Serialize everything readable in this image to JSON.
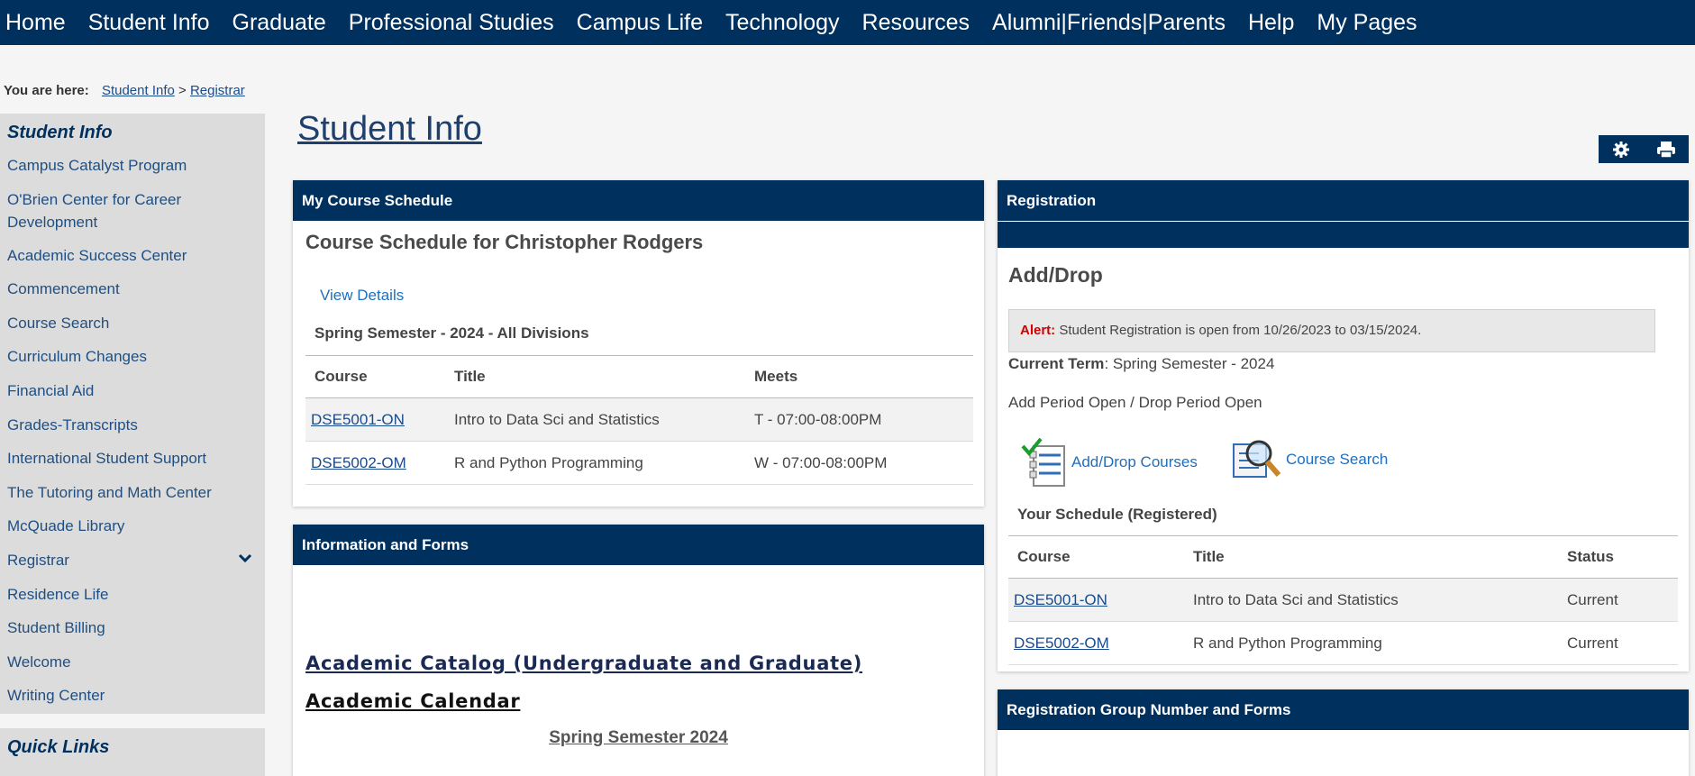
{
  "nav": [
    "Home",
    "Student Info",
    "Graduate",
    "Professional Studies",
    "Campus Life",
    "Technology",
    "Resources",
    "Alumni|Friends|Parents",
    "Help",
    "My Pages"
  ],
  "breadcrumb": {
    "label": "You are here:",
    "items": [
      "Student Info",
      "Registrar"
    ],
    "separator": ">"
  },
  "sidebar": {
    "heading": "Student Info",
    "items": [
      "Campus Catalyst Program",
      "O'Brien Center for Career Development",
      "Academic Success Center",
      "Commencement",
      "Course Search",
      "Curriculum Changes",
      "Financial Aid",
      "Grades-Transcripts",
      "International Student Support",
      "The Tutoring and Math Center",
      "McQuade Library",
      "Registrar",
      "Residence Life",
      "Student Billing",
      "Welcome",
      "Writing Center"
    ],
    "expanded_item_icon": "chevron-down-icon",
    "quick_links_heading": "Quick Links"
  },
  "page_title": "Student Info",
  "tools": {
    "settings_icon": "gear-icon",
    "print_icon": "printer-icon"
  },
  "schedule": {
    "panel_title": "My Course Schedule",
    "heading": "Course Schedule for Christopher Rodgers",
    "view_details": "View Details",
    "semester": "Spring Semester - 2024 - All Divisions",
    "columns": [
      "Course",
      "Title",
      "Meets"
    ],
    "rows": [
      {
        "course": "DSE5001-ON",
        "title": "Intro to Data Sci and Statistics",
        "meets": "T - 07:00-08:00PM"
      },
      {
        "course": "DSE5002-OM",
        "title": "R and Python Programming",
        "meets": "W - 07:00-08:00PM"
      }
    ]
  },
  "info": {
    "panel_title": "Information and Forms",
    "catalog": "Academic Catalog (Undergraduate and Graduate)",
    "calendar": "Academic Calendar",
    "semester_link": "Spring Semester 2024"
  },
  "registration": {
    "panel_title": "Registration",
    "heading": "Add/Drop",
    "alert_label": "Alert:",
    "alert_text": "Student Registration is open from 10/26/2023 to 03/15/2024.",
    "term_label": "Current Term",
    "term_value": ": Spring Semester - 2024",
    "period": "Add Period Open / Drop Period Open",
    "add_drop_link": "Add/Drop Courses",
    "course_search_link": "Course Search",
    "schedule_title": "Your Schedule (Registered)",
    "columns": [
      "Course",
      "Title",
      "Status"
    ],
    "rows": [
      {
        "course": "DSE5001-ON",
        "title": "Intro to Data Sci and Statistics",
        "status": "Current"
      },
      {
        "course": "DSE5002-OM",
        "title": "R and Python Programming",
        "status": "Current"
      }
    ]
  },
  "group": {
    "panel_title": "Registration Group Number and Forms"
  },
  "colors": {
    "navy": "#00305e",
    "link": "#1f6fbf",
    "alert": "#d40000"
  }
}
